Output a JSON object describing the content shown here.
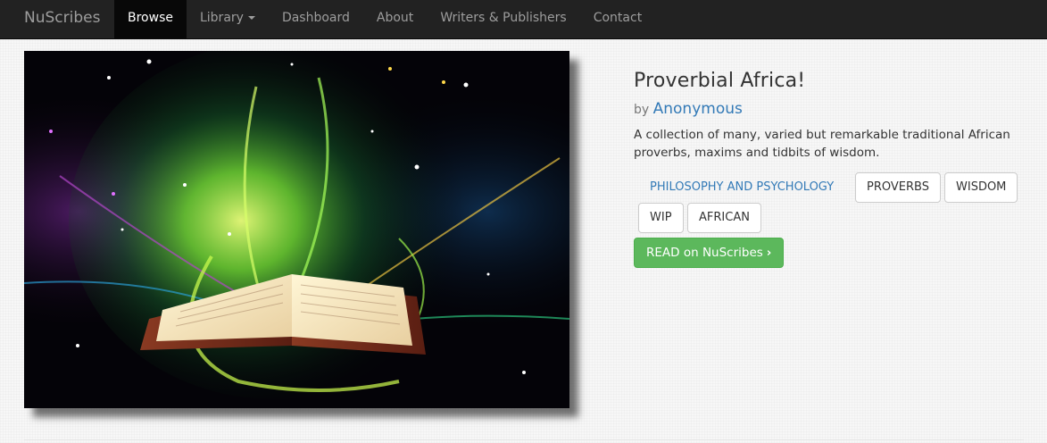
{
  "navbar": {
    "brand": "NuScribes",
    "items": [
      {
        "label": "Browse",
        "active": true
      },
      {
        "label": "Library",
        "dropdown": true
      },
      {
        "label": "Dashboard"
      },
      {
        "label": "About"
      },
      {
        "label": "Writers & Publishers"
      },
      {
        "label": "Contact"
      }
    ]
  },
  "book": {
    "title": "Proverbial Africa!",
    "by": "by",
    "author": "Anonymous",
    "description": "A collection of many, varied but remarkable traditional African proverbs, maxims and tidbits of wisdom.",
    "category": "PHILOSOPHY AND PSYCHOLOGY",
    "tags": [
      "PROVERBS",
      "WISDOM",
      "WIP",
      "AFRICAN"
    ],
    "read_label": "READ on NuScribes",
    "read_icon": "chevron-right-icon"
  },
  "colors": {
    "navbar_bg": "#222222",
    "active_bg": "#080808",
    "link": "#337ab7",
    "success": "#5cb85c"
  }
}
